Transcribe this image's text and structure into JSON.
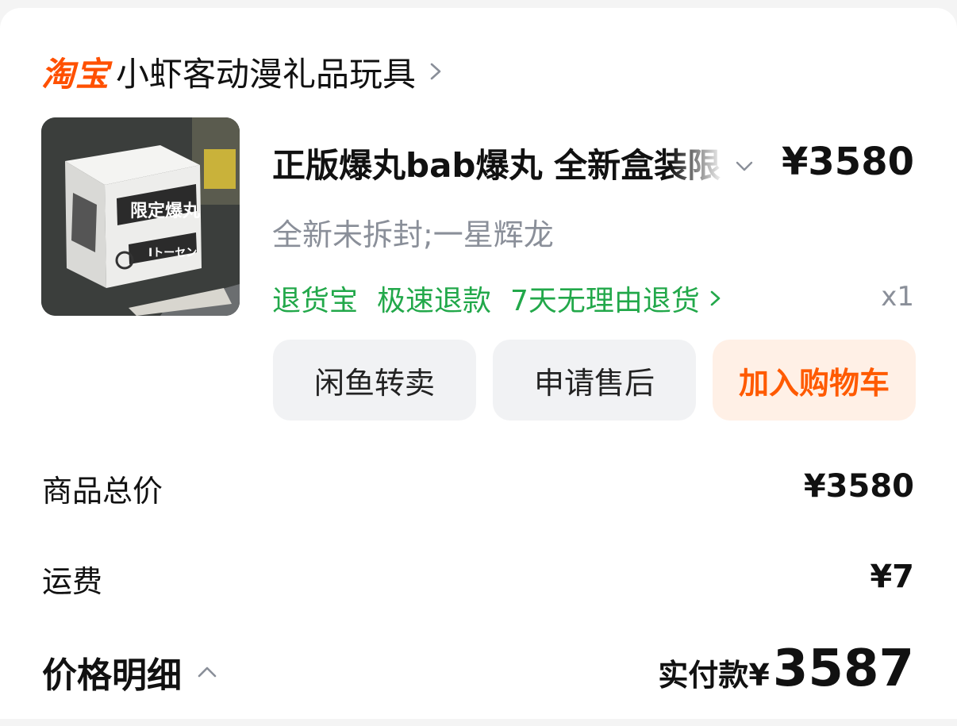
{
  "shop": {
    "platform_logo": "淘宝",
    "name": "小虾客动漫礼品玩具",
    "chevron_icon": "chevron-right-icon"
  },
  "product": {
    "title": "正版爆丸bab爆丸 全新盒装限",
    "price": "¥3580",
    "sku": "全新未拆封;一星辉龙",
    "quantity": "x1",
    "image_text": "限定爆丸",
    "image_subtext": "Iトーセン"
  },
  "services": {
    "items": [
      "退货宝",
      "极速退款",
      "7天无理由退货"
    ]
  },
  "actions": {
    "xianyu_resell": "闲鱼转卖",
    "after_sale": "申请售后",
    "add_to_cart": "加入购物车"
  },
  "summary": {
    "goods_total_label": "商品总价",
    "goods_total_value": "¥3580",
    "shipping_label": "运费",
    "shipping_value": "¥7",
    "price_detail_label": "价格明细",
    "paid_label": "实付款¥",
    "paid_value": "3587"
  },
  "colors": {
    "brand_orange": "#ff5000",
    "service_green": "#22a84a",
    "muted_gray": "#8a8f99"
  }
}
